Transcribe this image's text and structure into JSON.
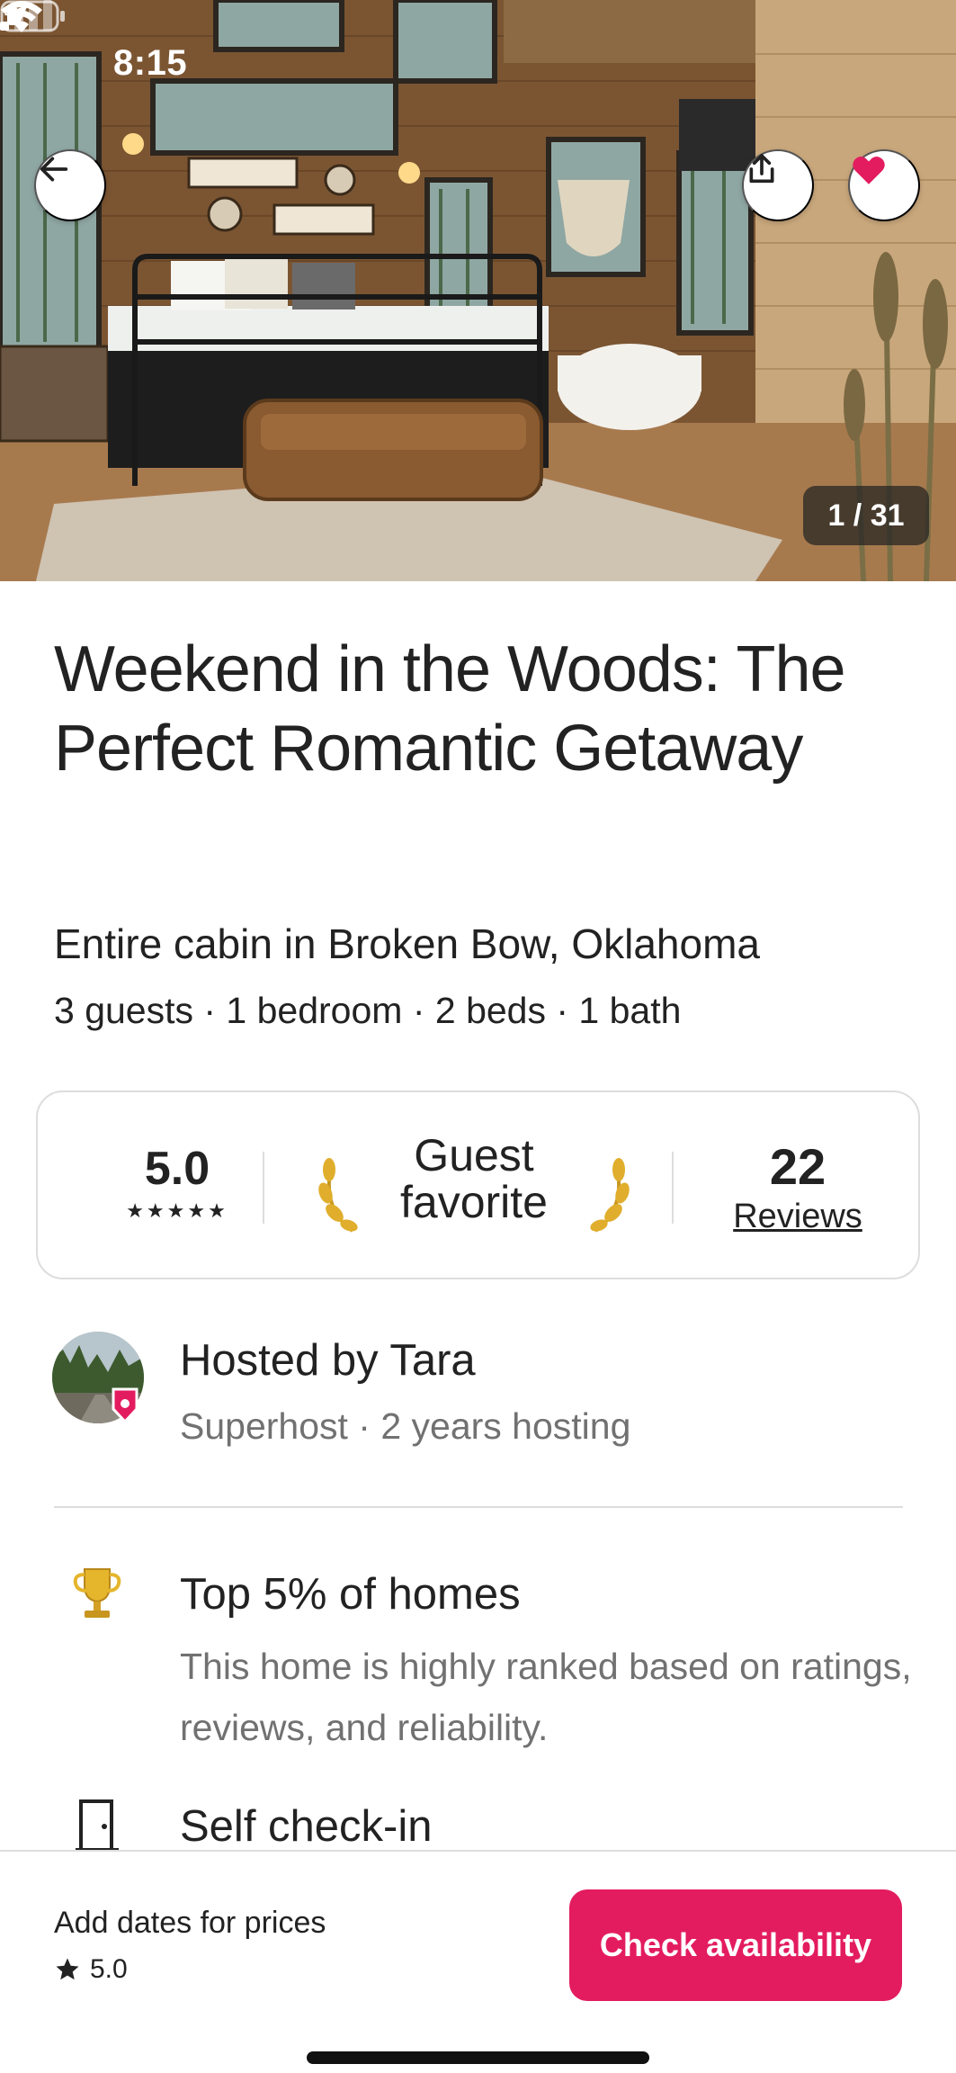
{
  "status_bar": {
    "time": "8:15",
    "icons": [
      "location-arrow-icon",
      "cellular-signal-icon",
      "wifi-icon",
      "battery-icon"
    ]
  },
  "hero": {
    "photo_counter": "1 / 31",
    "buttons": [
      "back-arrow-icon",
      "share-icon",
      "heart-icon"
    ],
    "heart_color": "#e31c5f"
  },
  "listing": {
    "title": "Weekend in the Woods: The Perfect Romantic Getaway",
    "subtitle": "Entire cabin in Broken Bow, Oklahoma",
    "details": "3 guests · 1 bedroom · 2 beds · 1 bath"
  },
  "stats": {
    "rating": "5.0",
    "stars": "★★★★★",
    "guest_favorite_line1": "Guest",
    "guest_favorite_line2": "favorite",
    "reviews_count": "22",
    "reviews_label": "Reviews"
  },
  "host": {
    "name": "Hosted by Tara",
    "subtitle": "Superhost · 2 years hosting"
  },
  "features": [
    {
      "icon": "trophy-icon",
      "title": "Top 5% of homes",
      "description": "This home is highly ranked based on ratings, reviews, and reliability."
    },
    {
      "icon": "door-icon",
      "title": "Self check-in"
    }
  ],
  "bottom_bar": {
    "add_dates": "Add dates for prices",
    "rating": "5.0",
    "check_availability": "Check availability",
    "accent_color": "#e31c5f"
  }
}
